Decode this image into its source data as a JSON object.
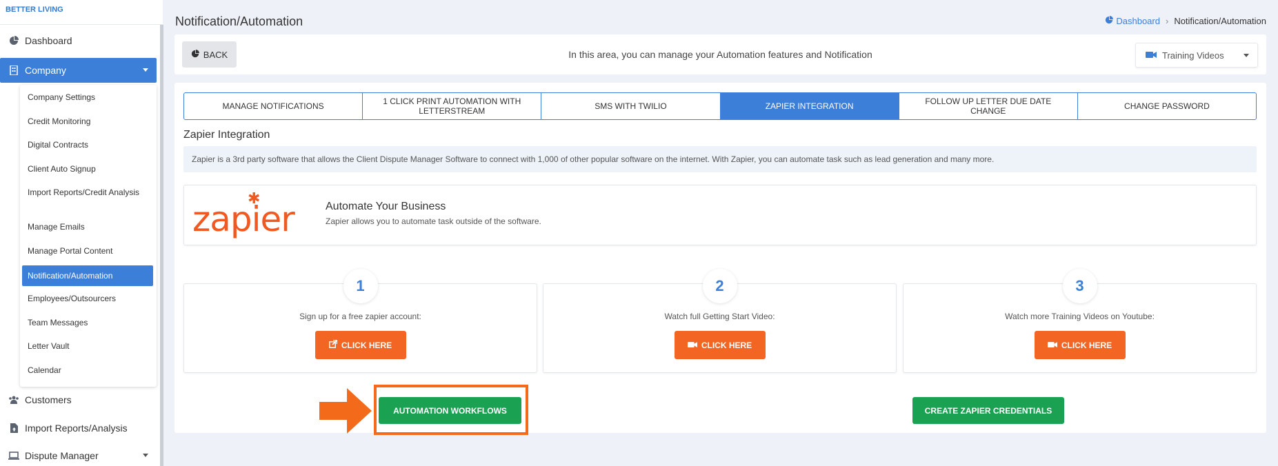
{
  "sidebar": {
    "brand": "BETTER LIVING",
    "items": [
      {
        "label": "Dashboard",
        "icon": "pie-chart-icon"
      },
      {
        "label": "Company",
        "icon": "building-icon"
      },
      {
        "label": "Customers",
        "icon": "users-icon"
      },
      {
        "label": "Import Reports/Analysis",
        "icon": "file-upload-icon"
      },
      {
        "label": "Dispute Manager",
        "icon": "laptop-icon"
      }
    ],
    "company_submenu": [
      "Company Settings",
      "Credit Monitoring",
      "Digital Contracts",
      "Client Auto Signup",
      "Import Reports/Credit Analysis",
      "Manage Emails",
      "Manage Portal Content",
      "Notification/Automation",
      "Employees/Outsourcers",
      "Team Messages",
      "Letter Vault",
      "Calendar"
    ]
  },
  "header": {
    "title": "Notification/Automation",
    "breadcrumb_home": "Dashboard",
    "breadcrumb_current": "Notification/Automation"
  },
  "topbar": {
    "back_label": "BACK",
    "info": "In this area, you can manage your Automation features and Notification",
    "training_label": "Training Videos"
  },
  "tabs": [
    "MANAGE NOTIFICATIONS",
    "1 CLICK PRINT AUTOMATION WITH LETTERSTREAM",
    "SMS WITH TWILIO",
    "ZAPIER INTEGRATION",
    "FOLLOW UP LETTER DUE DATE CHANGE",
    "CHANGE PASSWORD"
  ],
  "zapier": {
    "section_title": "Zapier Integration",
    "info": "Zapier is a 3rd party software that allows the Client Dispute Manager Software to connect with 1,000 of other popular software on the internet. With Zapier, you can automate task such as lead generation and many more.",
    "logo_text": "zapier",
    "card_title": "Automate Your Business",
    "card_sub": "Zapier allows you to automate task outside of the software.",
    "steps": [
      {
        "num": "1",
        "text": "Sign up for a free zapier account:",
        "button": "CLICK HERE"
      },
      {
        "num": "2",
        "text": "Watch full Getting Start Video:",
        "button": "CLICK HERE"
      },
      {
        "num": "3",
        "text": "Watch more Training Videos on Youtube:",
        "button": "CLICK HERE"
      }
    ],
    "workflows_button": "AUTOMATION WORKFLOWS",
    "credentials_button": "CREATE ZAPIER CREDENTIALS"
  },
  "colors": {
    "accent": "#3c7fd8",
    "orange": "#f26522",
    "green": "#1aa252",
    "highlight": "#f26a1a"
  }
}
